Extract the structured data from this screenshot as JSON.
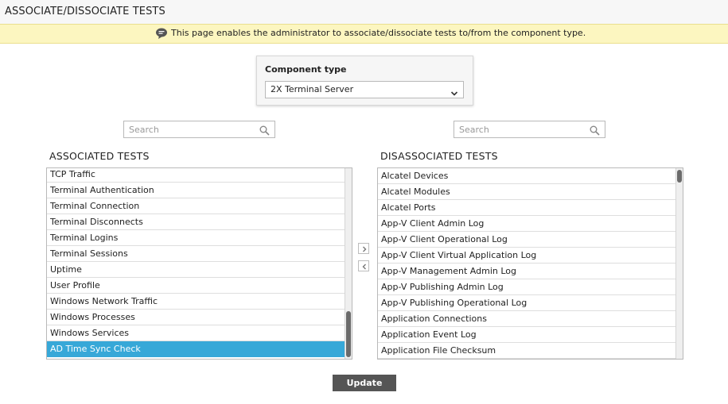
{
  "page": {
    "title": "ASSOCIATE/DISSOCIATE TESTS"
  },
  "info": {
    "icon": "speech-bubble-icon",
    "message": "This page enables the administrator to associate/dissociate tests to/from the component type."
  },
  "component_type": {
    "label": "Component type",
    "selected": "2X Terminal Server"
  },
  "associated": {
    "heading": "ASSOCIATED TESTS",
    "search_placeholder": "Search",
    "items": [
      "TCP Traffic",
      "Terminal Authentication",
      "Terminal Connection",
      "Terminal Disconnects",
      "Terminal Logins",
      "Terminal Sessions",
      "Uptime",
      "User Profile",
      "Windows Network Traffic",
      "Windows Processes",
      "Windows Services",
      "AD Time Sync Check"
    ],
    "selected": "AD Time Sync Check"
  },
  "disassociated": {
    "heading": "DISASSOCIATED TESTS",
    "search_placeholder": "Search",
    "items": [
      "Alcatel Devices",
      "Alcatel Modules",
      "Alcatel Ports",
      "App-V Client Admin Log",
      "App-V Client Operational Log",
      "App-V Client Virtual Application Log",
      "App-V Management Admin Log",
      "App-V Publishing Admin Log",
      "App-V Publishing Operational Log",
      "Application Connections",
      "Application Event Log",
      "Application File Checksum"
    ]
  },
  "actions": {
    "move_right_icon": "chevron-right-icon",
    "move_left_icon": "chevron-left-icon",
    "update_label": "Update"
  },
  "colors": {
    "selection": "#37a8d8",
    "info_bg": "#fcf6c0",
    "button_bg": "#555555"
  }
}
